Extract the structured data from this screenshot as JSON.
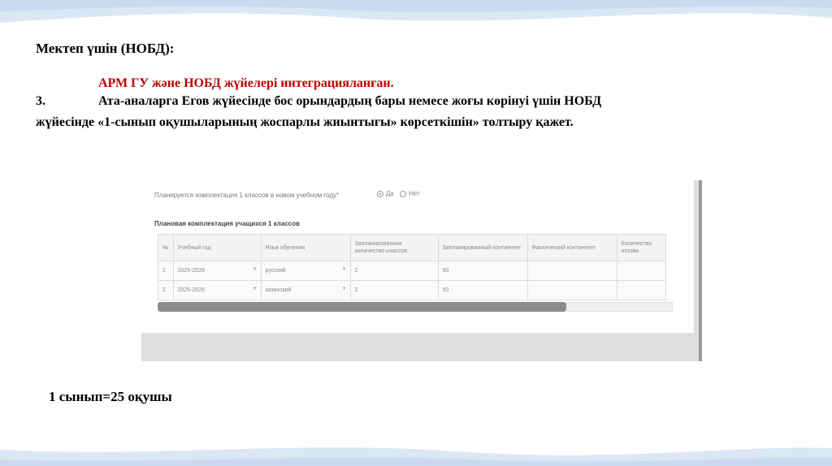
{
  "slide": {
    "heading": "Мектеп үшін (НОБД):",
    "red_line": "АРМ ГУ және НОБД жүйелері интеграцияланған.",
    "item_number": "3.",
    "paragraph_line1": "Ата-аналарга Егов жүйесінде бос орындардың бары немесе жоғы көрінуі үшін НОБД",
    "paragraph_line2": "жүйесінде «1-сынып оқушыларының жоспарлы жиынтығы» көрсеткішін» толтыру қажет.",
    "bottom_text": "1 сынып=25 оқушы",
    "colors": {
      "accent_red": "#c00000",
      "wave": "#c9daf0"
    }
  },
  "screenshot": {
    "question": "Планируется комплектация 1 классов в новом учебном году*",
    "radio_yes": "Да",
    "radio_no": "Нет",
    "table_title": "Плановая комплектация учащихся 1 классов",
    "columns": [
      "№",
      "Учебный год",
      "Язык обучения",
      "Запланированное количество классов",
      "Запланированный контингент",
      "Фактический контингент",
      "Количество отозва"
    ],
    "rows": [
      [
        "1",
        "2025-2026",
        "русский",
        "2",
        "50",
        "",
        ""
      ],
      [
        "2",
        "2025-2026",
        "казахский",
        "2",
        "50",
        "",
        ""
      ]
    ],
    "dropdown_arrow": "▼"
  }
}
